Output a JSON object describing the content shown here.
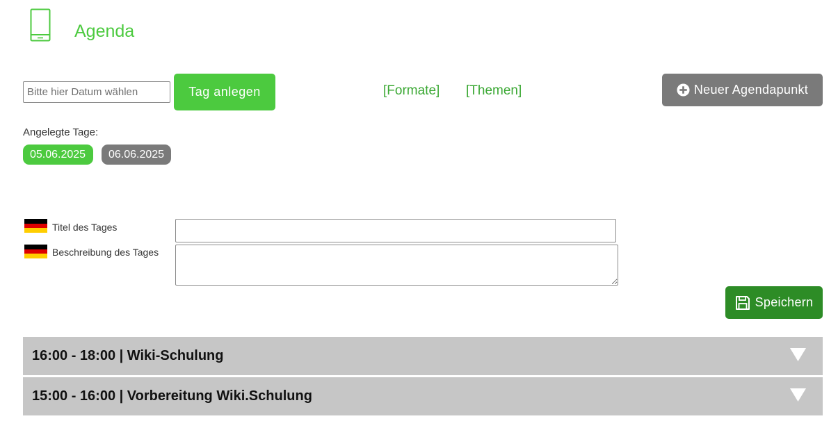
{
  "header": {
    "icon": "phone-icon",
    "title": "Agenda"
  },
  "toolbar": {
    "date_placeholder": "Bitte hier Datum wählen",
    "create_day_label": "Tag anlegen",
    "formats_link": "[Formate]",
    "themes_link": "[Themen]",
    "new_item_icon": "plus-circle-icon",
    "new_item_label": "Neuer Agendapunkt"
  },
  "days": {
    "label": "Angelegte Tage:",
    "items": [
      {
        "label": "05.06.2025",
        "active": true
      },
      {
        "label": "06.06.2025",
        "active": false
      }
    ]
  },
  "form": {
    "language_flag": "german-flag-icon",
    "title_label": "Titel des Tages",
    "title_value": "",
    "description_label": "Beschreibung des Tages",
    "description_value": "",
    "save_icon": "floppy-disk-icon",
    "save_label": "Speichern"
  },
  "agenda": {
    "items": [
      {
        "label": "16:00 - 18:00 | Wiki-Schulung"
      },
      {
        "label": "15:00 - 16:00 | Vorbereitung Wiki.Schulung"
      }
    ]
  },
  "colors": {
    "brand_green": "#4cca3f",
    "link_green": "#3aa833",
    "save_green": "#2d8c26",
    "neutral_grey": "#7a7a7a",
    "agenda_bg": "#c6c6c6"
  }
}
